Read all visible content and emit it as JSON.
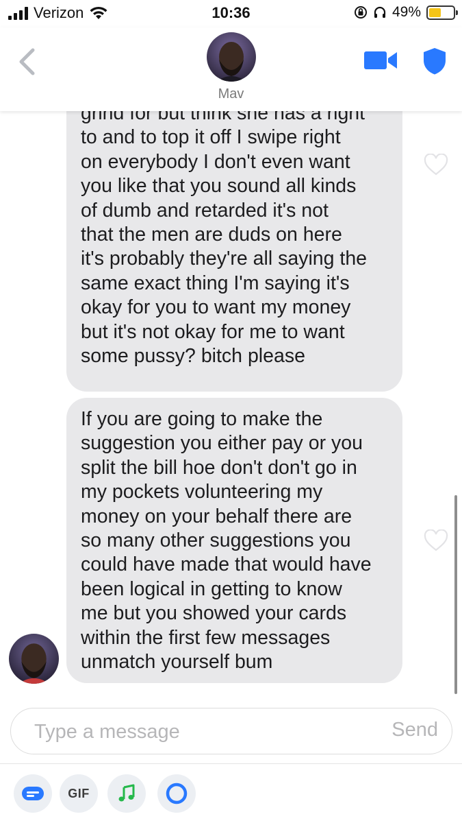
{
  "status_bar": {
    "carrier": "Verizon",
    "time": "10:36",
    "battery_percent": "49%",
    "battery_level": 0.49,
    "icons": [
      "signal-icon",
      "wifi-icon",
      "orientation-lock-icon",
      "headphones-icon",
      "battery-icon"
    ]
  },
  "header": {
    "match_name": "Mav",
    "icons": [
      "back-chevron-icon",
      "video-call-icon",
      "safety-shield-icon"
    ]
  },
  "messages": [
    {
      "text": "grind for but think she has a right\nto and to top it off I swipe right\non everybody I don't even want\nyou like that you sound all kinds\nof dumb and retarded it's not\nthat the men are duds on here\nit's probably they're all saying the\nsame exact thing I'm saying it's\nokay for you to want my money\nbut it's not okay for me to want\nsome pussy? bitch please",
      "liked": false
    },
    {
      "text": "If you are going to make the\nsuggestion you either pay or you\nsplit the bill hoe don't don't go in\nmy pockets volunteering my\nmoney on your behalf there are\nso many other suggestions you\ncould have made that would have\nbeen logical in getting to know\nme but you showed your cards\nwithin the first few messages\nunmatch yourself bum",
      "liked": false
    }
  ],
  "composer": {
    "placeholder": "Type a message",
    "value": "",
    "send_label": "Send"
  },
  "toolbar": {
    "gif_label": "GIF",
    "icons": [
      "sticker-icon",
      "gif-icon",
      "music-icon",
      "loops-icon"
    ]
  },
  "colors": {
    "accent_blue": "#2979ff",
    "bubble_gray": "#e8e8ea",
    "placeholder_gray": "#b6b6b8",
    "music_green": "#25b84b",
    "battery_yellow": "#f5c518"
  }
}
